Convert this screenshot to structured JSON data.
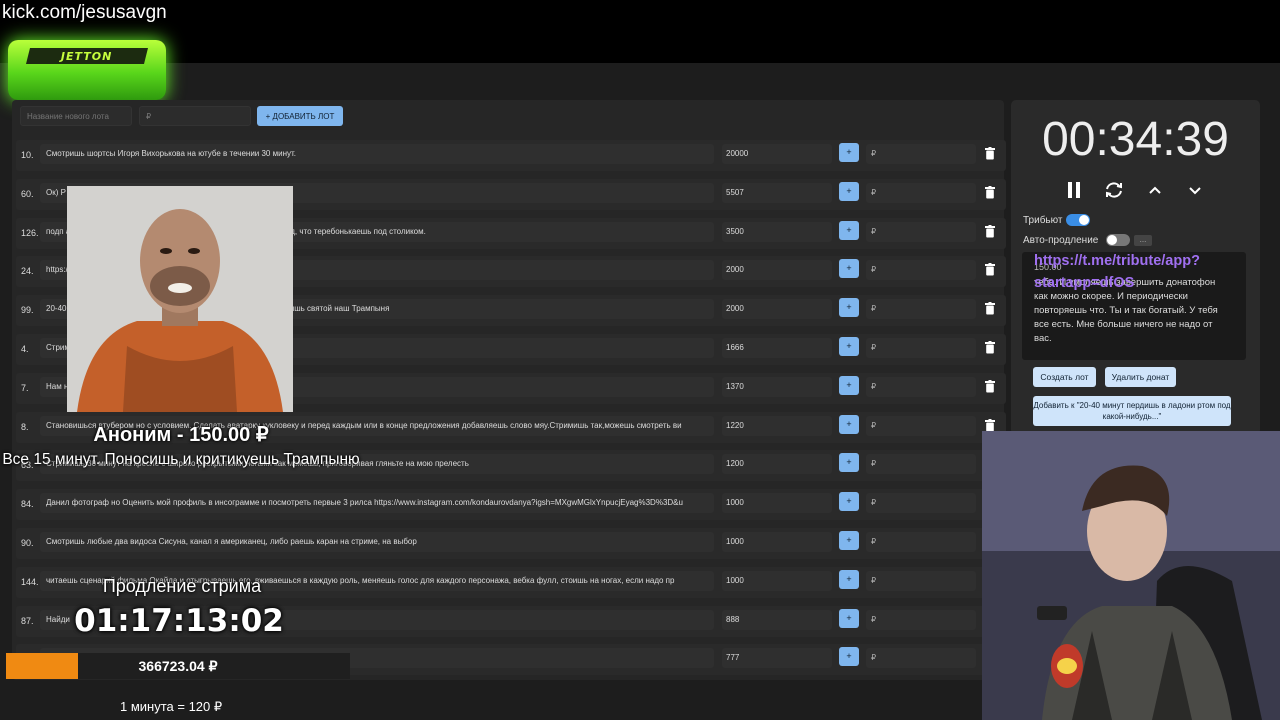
{
  "overlay": {
    "url": "kick.com/jesusavgn",
    "logo_text": "JETTON",
    "donor_title": "Аноним - 150.00 ₽",
    "donor_message": "Все 15 минут. Поносишь и критикуешь Трампыню",
    "extension_label": "Продление стрима",
    "extension_timer": "01:17:13:02",
    "total_amount": "366723.04 ₽",
    "progress_fraction": 0.21,
    "rate": "1 минута = 120 ₽"
  },
  "add_lot": {
    "name_placeholder": "Название нового лота",
    "amount_placeholder": "₽",
    "add_button": "+ ДОБАВИТЬ ЛОТ"
  },
  "lots": [
    {
      "num": "10.",
      "title": "Смотришь шортсы Игоря Вихорькова на ютубе в течении 30 минут.",
      "price": "20000",
      "plus": "+",
      "amount": "₽"
    },
    {
      "num": "60.",
      "title": "Ок) Р",
      "price": "5507",
      "plus": "+",
      "amount": "₽"
    },
    {
      "num": "126.",
      "title": "подп                                                              аешь посты и сторис лайкая и коментируя. Иногда делай вид, что теребонькаешь под столиком.",
      "price": "3500",
      "plus": "+",
      "amount": "₽"
    },
    {
      "num": "24.",
      "title": "https:/",
      "price": "2000",
      "plus": "+",
      "amount": "₽"
    },
    {
      "num": "99.",
      "title": "20-40                                                                ский рок стоя и встаешь на колени, молишься и потом кричишь святой наш Трампыня",
      "price": "2000",
      "plus": "+",
      "amount": "₽"
    },
    {
      "num": "4.",
      "title": "Стрим",
      "price": "1666",
      "plus": "+",
      "amount": "₽"
    },
    {
      "num": "7.",
      "title": "Нам ну",
      "price": "1370",
      "plus": "+",
      "amount": "₽"
    },
    {
      "num": "8.",
      "title": "Становишься втубером но с условием. Сделать аватарку кукловеку и перед каждым или в конце предложения добавляешь слово мяу.Стримишь так,можешь смотреть ви",
      "price": "1220",
      "plus": "+",
      "amount": "₽"
    },
    {
      "num": "63.",
      "title": "Стримишь 30 минут на кресле с широко раскрытыми ногами как можешь, приговоривая гляньте на мою прелесть",
      "price": "1200",
      "plus": "+",
      "amount": "₽"
    },
    {
      "num": "84.",
      "title": "Данил фотограф но Оценить мой профиль в инсограмме и посмотреть первые 3 рилса https://www.instagram.com/kondaurovdanya?igsh=MXgwMGlxYnpucjEyag%3D%3D&u",
      "price": "1000",
      "plus": "+",
      "amount": "₽"
    },
    {
      "num": "90.",
      "title": "Смотришь любые два видоса Сисуна, канал я американец, либо раешь каран на стриме, на выбор",
      "price": "1000",
      "plus": "+",
      "amount": "₽"
    },
    {
      "num": "144.",
      "title": "читаешь сценарий фильма Окайда и отыгрываешь его, вживаешься в каждую роль, меняешь голос для каждого персонажа, вебка фулл, стоишь на ногах, если надо пр",
      "price": "1000",
      "plus": "+",
      "amount": "₽"
    },
    {
      "num": "87.",
      "title": "Найди",
      "price": "888",
      "plus": "+",
      "amount": "₽"
    },
    {
      "num": "",
      "title": "",
      "price": "777",
      "plus": "+",
      "amount": "₽"
    }
  ],
  "side": {
    "timer": "00:34:39",
    "tribute_label": "Трибьют",
    "auto_label": "Авто-продление",
    "dots": "...",
    "link": "https://t.me/tribute/app?startapp=dfOS",
    "small_amount": "150.00",
    "message": "тебе. И умоляешь завершить донатофон как можно скорее. И периодически повторяешь что. Ты и так богатый. У тебя все есть. Мне больше ничего не надо от вас.",
    "create_lot": "Создать лот",
    "delete_donat": "Удалить донат",
    "add_to_lot": "Добавить к \"20-40 минут пердишь в ладони ртом под какой-нибудь...\""
  }
}
